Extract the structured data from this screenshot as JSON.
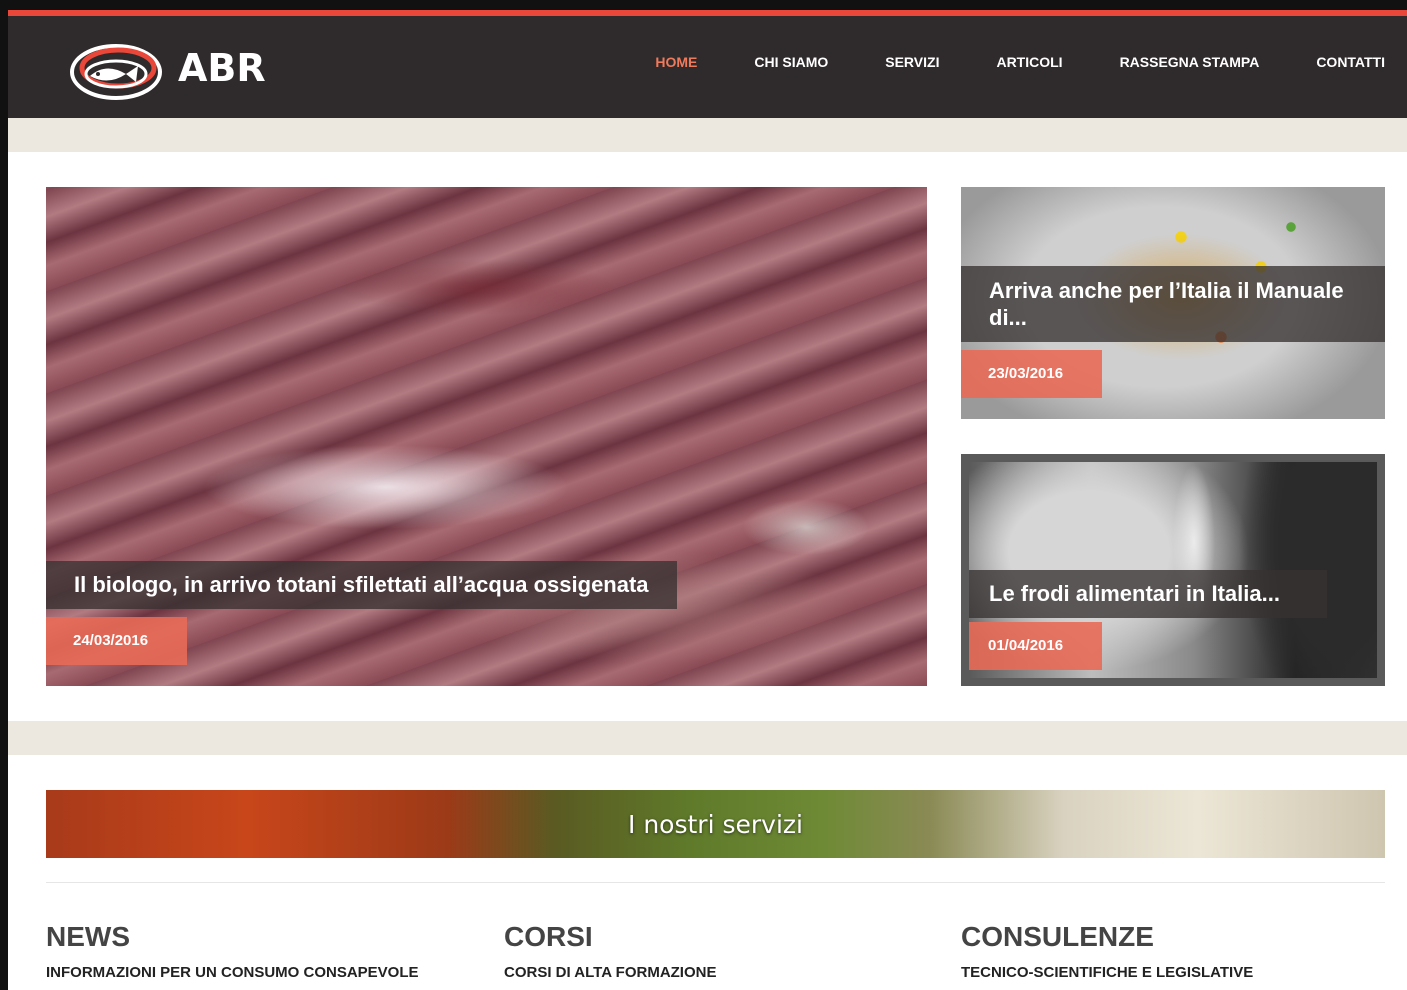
{
  "header": {
    "logo_text": "ABR",
    "nav": [
      {
        "label": "HOME",
        "active": true
      },
      {
        "label": "CHI SIAMO",
        "active": false
      },
      {
        "label": "SERVIZI",
        "active": false
      },
      {
        "label": "ARTICOLI",
        "active": false
      },
      {
        "label": "RASSEGNA STAMPA",
        "active": false
      },
      {
        "label": "CONTATTI",
        "active": false
      }
    ]
  },
  "featured": {
    "main": {
      "title": "Il biologo, in arrivo totani sfilettati all’acqua ossigenata",
      "date": "24/03/2016"
    },
    "top": {
      "title": "Arriva anche per l’Italia il Manuale di...",
      "date": "23/03/2016"
    },
    "bottom": {
      "title": "Le frodi alimentari in Italia...",
      "date": "01/04/2016"
    }
  },
  "services": {
    "banner_title": "I nostri servizi",
    "columns": [
      {
        "title": "NEWS",
        "subtitle": "INFORMAZIONI PER UN CONSUMO CONSAPEVOLE"
      },
      {
        "title": "CORSI",
        "subtitle": "CORSI DI ALTA FORMAZIONE"
      },
      {
        "title": "CONSULENZE",
        "subtitle": "TECNICO-SCIENTIFICHE E LEGISLATIVE"
      }
    ]
  },
  "colors": {
    "accent": "#e8473a",
    "header_bg": "#2f2a2b",
    "date_badge": "#e96a56",
    "nav_active": "#f07a5c"
  },
  "icons": {
    "logo": "fish-plate-logo-icon"
  }
}
